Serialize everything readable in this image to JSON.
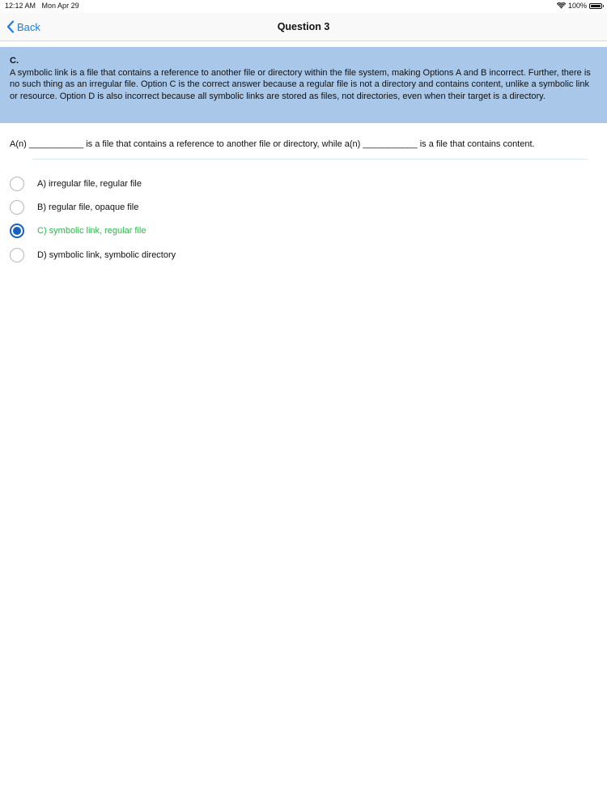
{
  "status_bar": {
    "time": "12:12 AM",
    "date": "Mon Apr 29",
    "battery_percent": "100%",
    "battery_level": 1.0,
    "wifi_icon": "wifi-icon",
    "battery_icon": "battery-icon"
  },
  "nav": {
    "back_label": "Back",
    "back_icon": "chevron-left-icon",
    "title": "Question 3",
    "accent_color": "#1a7be6"
  },
  "explanation": {
    "answer": "C.",
    "text": "A symbolic link is a file that contains a reference to another file or directory within the file system, making Options A and B incorrect. Further, there is no such thing as an irregular file. Option C is the correct answer because a regular file is not a directory and contains content, unlike a symbolic link or resource. Option D is also incorrect because all symbolic links are stored as files, not directories, even when their target is a directory.",
    "background_color": "#a9c7e8"
  },
  "question": {
    "text": "A(n) ___________ is a file that contains a reference to another file or directory, while a(n) ___________ is a file that contains content."
  },
  "options": [
    {
      "label": "A) irregular file, regular file",
      "selected": false,
      "correct": false
    },
    {
      "label": "B) regular file, opaque file",
      "selected": false,
      "correct": false
    },
    {
      "label": "C) symbolic link, regular file",
      "selected": true,
      "correct": true
    },
    {
      "label": "D) symbolic link, symbolic directory",
      "selected": false,
      "correct": false
    }
  ],
  "colors": {
    "correct_text": "#2cb84a",
    "selected_radio": "#1561c0"
  }
}
